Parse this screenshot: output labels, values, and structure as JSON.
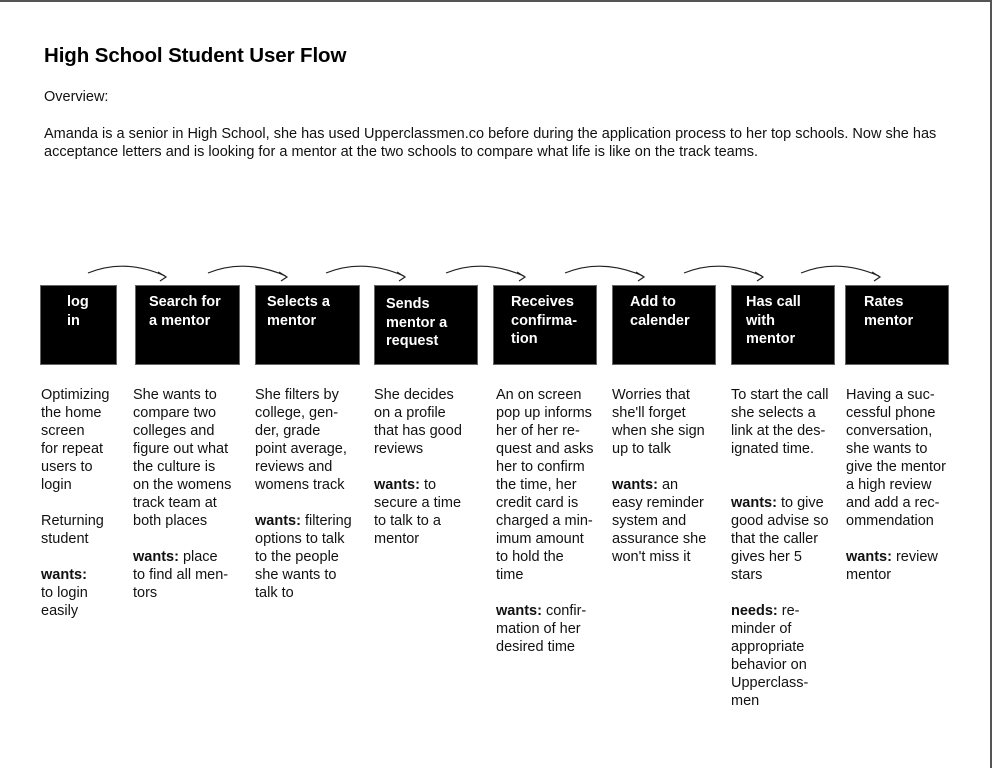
{
  "document": {
    "title": "High School Student User Flow",
    "overview_label": "Overview:",
    "overview_text": "Amanda is a senior in High School, she has used Upperclassmen.co before during the application process to her top schools. Now she has acceptance letters and is looking for a mentor at the two schools to compare what life is like on the track teams."
  },
  "flow": {
    "steps": [
      {
        "label": "log\nin",
        "description": "Optimizing\nthe home\nscreen\nfor repeat\nusers to\nlogin",
        "extra": "Returning\nstudent",
        "wants_key": "wants:",
        "wants_text": "\nto login\neasily"
      },
      {
        "label": "Search for\na mentor",
        "description": "She wants to\ncompare two\ncolleges and\nfigure out what\nthe culture is\non the womens\ntrack team at\nboth places",
        "wants_key": "wants:",
        "wants_text": " place\nto find all men-\ntors"
      },
      {
        "label": "Selects a\nmentor",
        "description": "She filters by\ncollege, gen-\nder, grade\npoint average,\nreviews and\nwomens track",
        "wants_key": "wants:",
        "wants_text": " filtering\noptions to talk\nto the people\nshe wants to\ntalk to"
      },
      {
        "label": "Sends\nmentor a\nrequest",
        "description": "She decides\non a profile\nthat has good\nreviews",
        "wants_key": "wants:",
        "wants_text": " to\nsecure a time\nto talk to a\nmentor"
      },
      {
        "label": "Receives\nconfirma-\ntion",
        "description": "An on screen\npop up informs\nher of her re-\nquest and asks\nher to confirm\nthe time, her\ncredit card is\ncharged a min-\nimum amount\nto hold the\ntime",
        "wants_key": "wants:",
        "wants_text": " confir-\nmation of her\ndesired time"
      },
      {
        "label": "Add to\ncalender",
        "description": "Worries that\nshe'll forget\nwhen she sign\nup to talk",
        "wants_key": "wants:",
        "wants_text": " an\neasy reminder\nsystem and\nassurance she\nwon't miss it"
      },
      {
        "label": "Has call\nwith\nmentor",
        "description": "To start the call\nshe selects a\nlink at the des-\nignated time.",
        "wants_key": "wants:",
        "wants_text": " to give\ngood advise so\nthat the caller\ngives her 5\nstars",
        "needs_key": "needs:",
        "needs_text": " re-\nminder of\nappropriate\nbehavior on\nUpperclass-\nmen"
      },
      {
        "label": "Rates\nmentor",
        "description": "Having a suc-\ncessful phone\nconversation,\nshe wants to\ngive the mentor\na high review\nand add a rec-\nommendation",
        "wants_key": "wants:",
        "wants_text": " review\nmentor"
      }
    ]
  }
}
